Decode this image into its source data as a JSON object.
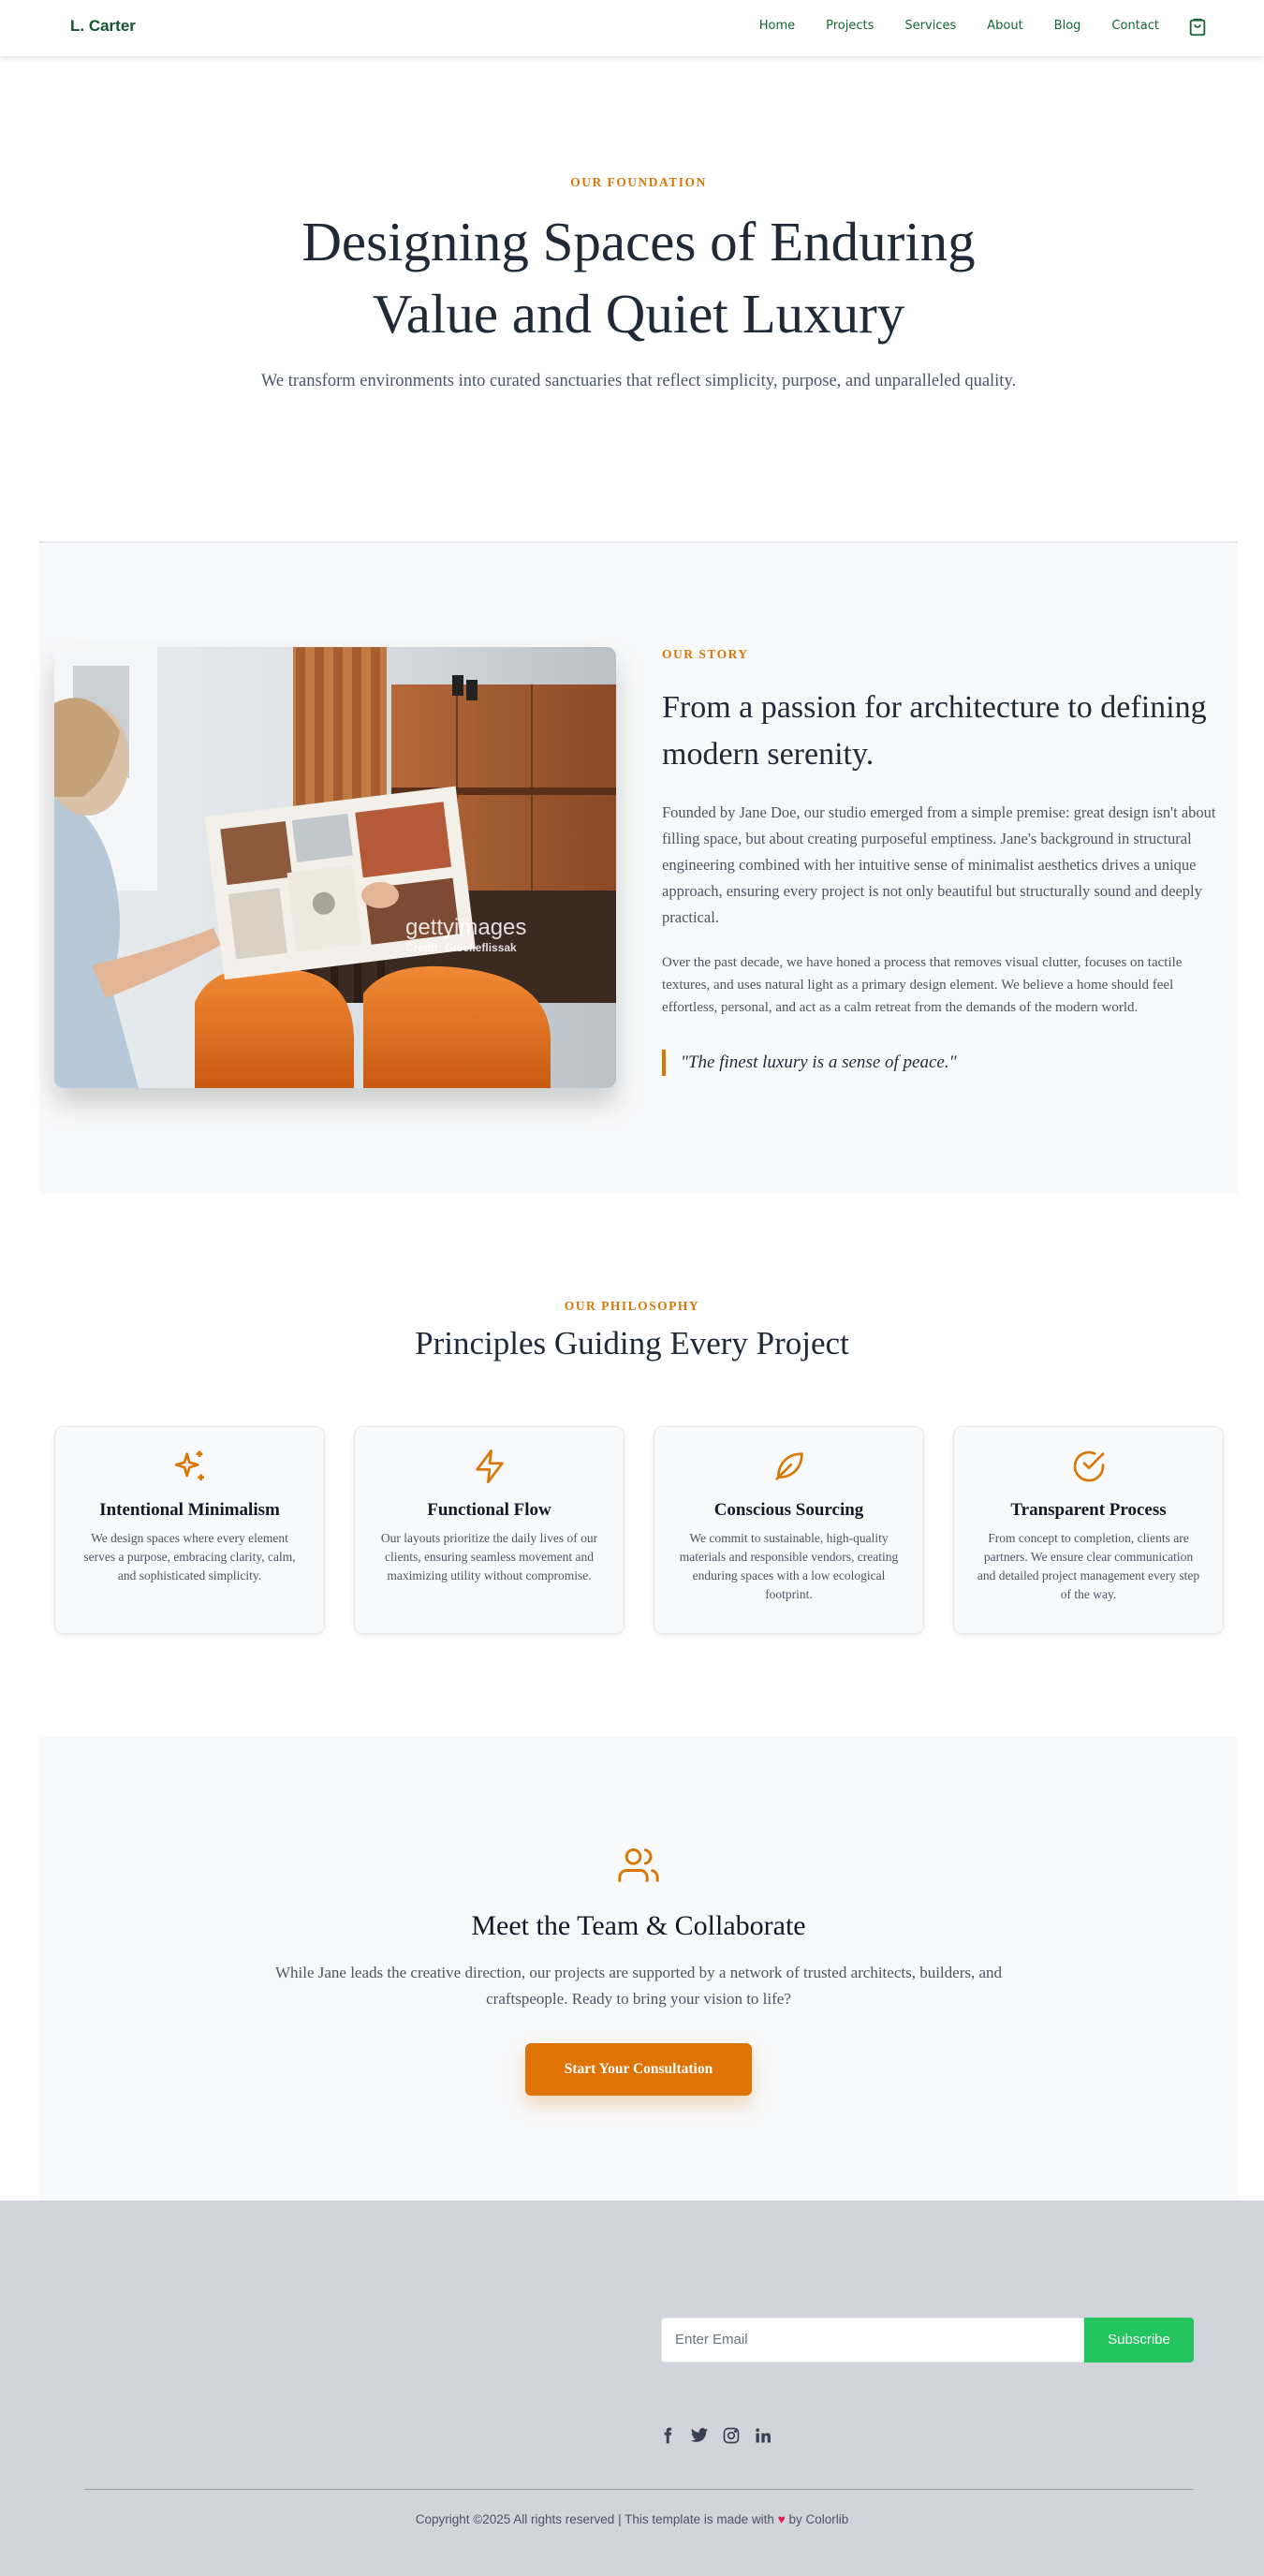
{
  "nav": {
    "brand": "L. Carter",
    "links": [
      "Home",
      "Projects",
      "Services",
      "About",
      "Blog",
      "Contact"
    ],
    "cart_icon": "shopping-bag-icon"
  },
  "hero": {
    "eyebrow": "OUR FOUNDATION",
    "title": "Designing Spaces of Enduring Value and Quiet Luxury",
    "subtitle": "We transform environments into curated sanctuaries that reflect simplicity, purpose, and unparalleled quality."
  },
  "story": {
    "image_caption": "gettyimages",
    "image_credit": "Credit: Giselleflissak",
    "eyebrow": "OUR STORY",
    "title": "From a passion for architecture to defining modern serenity.",
    "paragraph1": "Founded by Jane Doe, our studio emerged from a simple premise: great design isn't about filling space, but about creating purposeful emptiness. Jane's background in structural engineering combined with her intuitive sense of minimalist aesthetics drives a unique approach, ensuring every project is not only beautiful but structurally sound and deeply practical.",
    "paragraph2": "Over the past decade, we have honed a process that removes visual clutter, focuses on tactile textures, and uses natural light as a primary design element. We believe a home should feel effortless, personal, and act as a calm retreat from the demands of the modern world.",
    "quote": "\"The finest luxury is a sense of peace.\""
  },
  "philosophy": {
    "eyebrow": "OUR PHILOSOPHY",
    "title": "Principles Guiding Every Project",
    "cards": [
      {
        "icon": "sparkles-icon",
        "title": "Intentional Minimalism",
        "text": "We design spaces where every element serves a purpose, embracing clarity, calm, and sophisticated simplicity."
      },
      {
        "icon": "lightning-icon",
        "title": "Functional Flow",
        "text": "Our layouts prioritize the daily lives of our clients, ensuring seamless movement and maximizing utility without compromise."
      },
      {
        "icon": "leaf-icon",
        "title": "Conscious Sourcing",
        "text": "We commit to sustainable, high-quality materials and responsible vendors, creating enduring spaces with a low ecological footprint."
      },
      {
        "icon": "check-circle-icon",
        "title": "Transparent Process",
        "text": "From concept to completion, clients are partners. We ensure clear communication and detailed project management every step of the way."
      }
    ]
  },
  "team": {
    "icon": "users-icon",
    "title": "Meet the Team & Collaborate",
    "text": "While Jane leads the creative direction, our projects are supported by a network of trusted architects, builders, and craftspeople. Ready to bring your vision to life?",
    "cta": "Start Your Consultation"
  },
  "footer": {
    "email_placeholder": "Enter Email",
    "subscribe_label": "Subscribe",
    "social": [
      "facebook-icon",
      "twitter-icon",
      "instagram-icon",
      "linkedin-icon"
    ],
    "copyright_prefix": "Copyright ©2025 All rights reserved | This template is made with",
    "copyright_suffix": "by Colorlib"
  },
  "colors": {
    "accent": "#d97706",
    "button": "#e07306",
    "brand_green": "#14532d",
    "subscribe_green": "#22c55e",
    "footer_bg": "#d1d5db"
  }
}
